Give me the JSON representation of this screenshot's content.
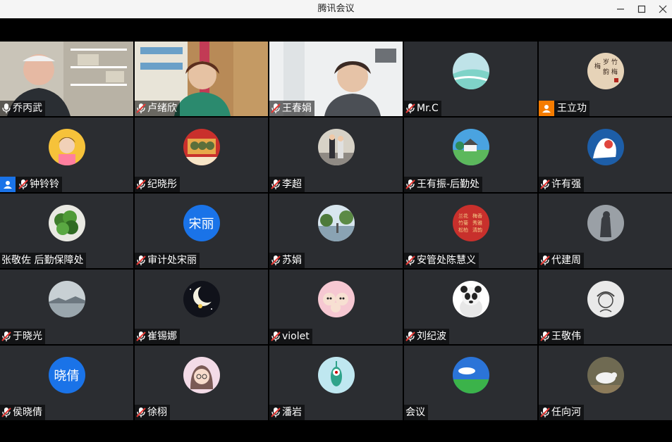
{
  "window": {
    "title": "腾讯会议"
  },
  "participants": [
    {
      "name": "乔丙武",
      "kind": "video",
      "scene": "bookshelf-man",
      "speaking": true,
      "mic": "on"
    },
    {
      "name": "卢绪欣",
      "kind": "video",
      "scene": "bookshelf-woman",
      "mic": "muted"
    },
    {
      "name": "王春娟",
      "kind": "video",
      "scene": "office-woman",
      "mic": "muted"
    },
    {
      "name": "Mr.C",
      "kind": "avatar",
      "avatar": "beach",
      "mic": "muted"
    },
    {
      "name": "王立功",
      "kind": "avatar",
      "avatar": "calligraphy",
      "mic": "none",
      "badge": "user-orange"
    },
    {
      "name": "钟铃铃",
      "kind": "avatar",
      "avatar": "girl-yellow",
      "mic": "muted",
      "badge": "user-blue"
    },
    {
      "name": "纪晓彤",
      "kind": "avatar",
      "avatar": "red-poster",
      "mic": "muted"
    },
    {
      "name": "李超",
      "kind": "avatar",
      "avatar": "couple-photo",
      "mic": "muted"
    },
    {
      "name": "王有振-后勤处",
      "kind": "avatar",
      "avatar": "house-field",
      "mic": "muted"
    },
    {
      "name": "许有强",
      "kind": "avatar",
      "avatar": "blue-art",
      "mic": "muted"
    },
    {
      "name": "张敬佐  后勤保障处",
      "kind": "avatar",
      "avatar": "plant",
      "mic": "none"
    },
    {
      "name": "审计处宋丽",
      "kind": "avatar",
      "avatar_text": "宋丽",
      "mic": "muted"
    },
    {
      "name": "苏娟",
      "kind": "avatar",
      "avatar": "park",
      "mic": "muted"
    },
    {
      "name": "安管处陈慧义",
      "kind": "avatar",
      "avatar": "red-seal",
      "mic": "muted"
    },
    {
      "name": "代建周",
      "kind": "avatar",
      "avatar": "statue",
      "mic": "muted"
    },
    {
      "name": "于晓光",
      "kind": "avatar",
      "avatar": "sea-fog",
      "mic": "muted"
    },
    {
      "name": "崔锡娜",
      "kind": "avatar",
      "avatar": "moon",
      "mic": "muted"
    },
    {
      "name": "violet",
      "kind": "avatar",
      "avatar": "cartoon-family",
      "mic": "muted"
    },
    {
      "name": "刘纪波",
      "kind": "avatar",
      "avatar": "panda",
      "mic": "muted"
    },
    {
      "name": "王敬伟",
      "kind": "avatar",
      "avatar": "sketch",
      "mic": "muted"
    },
    {
      "name": "侯晓倩",
      "kind": "avatar",
      "avatar_text": "晓倩",
      "mic": "muted"
    },
    {
      "name": "徐栩",
      "kind": "avatar",
      "avatar": "cartoon-girl",
      "mic": "muted"
    },
    {
      "name": "潘岩",
      "kind": "avatar",
      "avatar": "plankton",
      "mic": "muted"
    },
    {
      "name": "会议",
      "kind": "avatar",
      "avatar": "sky-field",
      "mic": "none"
    },
    {
      "name": "任向河",
      "kind": "avatar",
      "avatar": "bird",
      "mic": "muted"
    }
  ],
  "colors": {
    "tile": "#2b2d31",
    "speaking": "#1ec97a",
    "avatarText": "#1a73e8",
    "muted": "#e53935"
  }
}
